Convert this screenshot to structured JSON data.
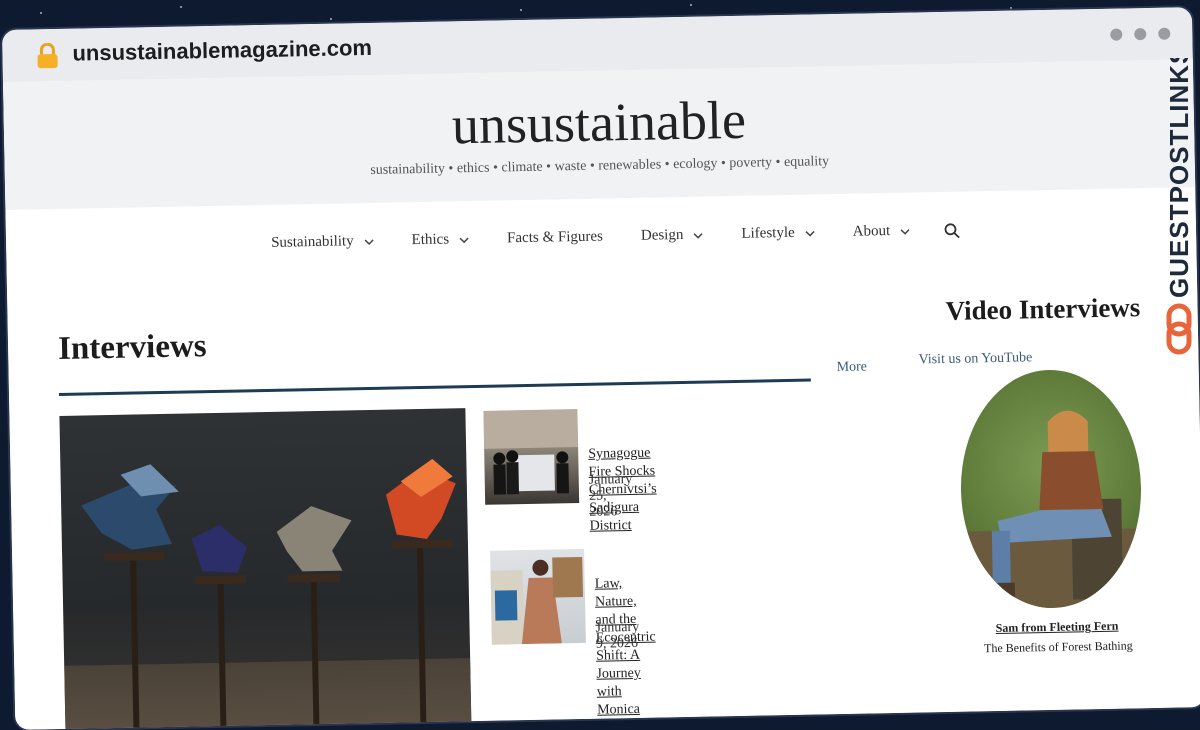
{
  "browser": {
    "url": "unsustainablemagazine.com"
  },
  "site": {
    "title": "unsustainable",
    "tagline": "sustainability • ethics • climate • waste • renewables • ecology • poverty • equality"
  },
  "nav": {
    "items": [
      {
        "label": "Sustainability",
        "dropdown": true
      },
      {
        "label": "Ethics",
        "dropdown": true
      },
      {
        "label": "Facts & Figures",
        "dropdown": false
      },
      {
        "label": "Design",
        "dropdown": true
      },
      {
        "label": "Lifestyle",
        "dropdown": true
      },
      {
        "label": "About",
        "dropdown": true
      }
    ],
    "search_icon": "search-icon"
  },
  "interviews": {
    "title": "Interviews",
    "more_label": "More",
    "articles": [
      {
        "title": "Synagogue Fire Shocks Chernivtsi’s Sadigura District",
        "date": "January 25, 2026"
      },
      {
        "title_line1": "Law, Nature, and the Ecocentric Shift: A Journey",
        "title_line2": "with Monica Feria-Tinta",
        "date": "January 9, 2026"
      }
    ]
  },
  "sidebar": {
    "title": "Video Interviews",
    "youtube_label": "Visit us on YouTube",
    "featured_name": "Sam from Fleeting Fern",
    "featured_subtitle": "The Benefits of Forest Bathing"
  },
  "watermark": {
    "text": "GUESTPOSTLINKS",
    "color": "#e8643a"
  },
  "colors": {
    "accent_rule": "#1d3b55",
    "link": "#3a5b7a"
  }
}
